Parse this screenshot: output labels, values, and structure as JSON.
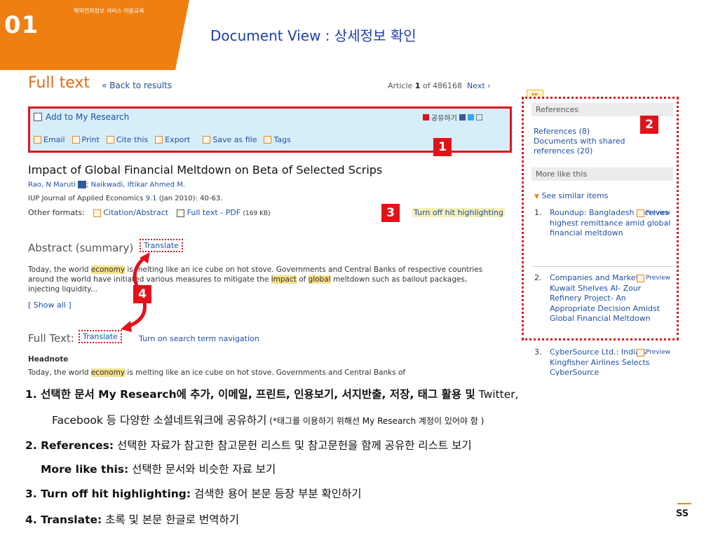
{
  "slide": {
    "number": "01",
    "subtitle": "해외전자정보 서비스 이용교육",
    "title": "Document View : 상세정보 확인"
  },
  "header": {
    "title": "Full text",
    "back_label": "« Back to results",
    "article_prefix": "Article ",
    "article_num": "1",
    "article_suffix": " of 486168",
    "next_label": "Next ›"
  },
  "toolbar": {
    "add_research": "Add to My Research",
    "share_label": "공유하기",
    "email": "Email",
    "print": "Print",
    "cite": "Cite this",
    "export": "Export",
    "save": "Save as file",
    "tags": "Tags"
  },
  "document": {
    "title": "Impact of Global Financial Meltdown on Beta of Selected Scrips",
    "author1": "Rao, N Maruti",
    "author2": "; Naikwadi, Iftikar Ahmed M.",
    "journal": "IUP Journal of Applied Economics",
    "volume": "9.1",
    "issue": " (Jan 2010): 40-63.",
    "other_formats_label": "Other formats:",
    "citation_abstract": "Citation/Abstract",
    "fulltext_pdf": "Full text - PDF",
    "pdf_size": "(169 KB)",
    "hit_highlight": "Turn off hit highlighting"
  },
  "abstract": {
    "heading": "Abstract (summary)",
    "translate": "Translate",
    "t1": "Today, the world ",
    "h1": "economy",
    "t2": " is melting like an ice cube on hot stove. Governments and Central Banks of respective countries around the world have initiated various measures to mitigate the ",
    "h2": "impact",
    "t3": " of ",
    "h3": "global",
    "t4": " meltdown such as bailout packages, injecting liquidity...",
    "show_all": "[ Show all ]"
  },
  "fulltext": {
    "heading": "Full Text:",
    "translate": "Translate",
    "search_nav": "Turn on search term navigation",
    "headnote": "Headnote",
    "t1": "Today, the world ",
    "h1": "economy",
    "t2": " is melting like an ice cube on hot stove. Governments and Central Banks of"
  },
  "sidebar": {
    "references_h": "References",
    "references": "References (8)",
    "shared_refs": "Documents with shared references (20)",
    "more_like_h": "More like this",
    "see_similar": "See similar items",
    "preview": "Preview",
    "items": [
      {
        "n": "1.",
        "title": "Roundup: Bangladesh receives highest remittance amid global financial meltdown"
      },
      {
        "n": "2.",
        "title": "Companies and Markets: Kuwait Shelves Al- Zour Refinery Project- An Appropriate Decision Amidst Global Financial Meltdown"
      },
      {
        "n": "3.",
        "title": "CyberSource Ltd.: India's Kingfisher Airlines Selects CyberSource"
      }
    ]
  },
  "markers": [
    "1",
    "2",
    "3",
    "4"
  ],
  "notes": {
    "l1_a": "1. 선택한 문서 My Research에 추가, 이메일, 프린트, 인용보기, 서지반출, 저장, 태그 활용 및",
    "l1_b": " Twitter,",
    "l1_c": "Facebook 등 다양한 소셜네트워크에 공유하기",
    "l1_d": " (*태그를 이용하기 위해선 My Research 계정이 있어야 함 )",
    "l2_a": "2. References:",
    "l2_b": " 선택한 자료가 참고한 참고문헌 리스트 및 참고문헌을 함께 공유한 리스트 보기",
    "l2c_a": "More like this:",
    "l2c_b": " 선택한 문서와 비슷한 자료 보기",
    "l3_a": "3. Turn off hit highlighting:",
    "l3_b": " 검색한 용어 본문 등장 부분 확인하기",
    "l4_a": "4. Translate:",
    "l4_b": " 초록 및 본문 한글로 번역하기",
    "logo": "SS"
  },
  "colors": {
    "accent": "#f07f12",
    "marker": "#e0131b",
    "link": "#1f4fa6",
    "toolbar_bg": "#d6eefa",
    "highlight": "#f6e08a"
  }
}
